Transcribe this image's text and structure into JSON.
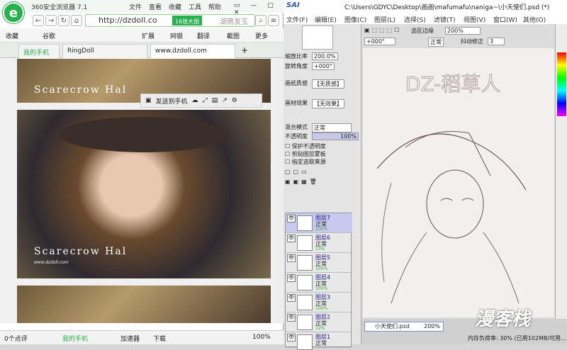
{
  "browser": {
    "logo": "e",
    "app_name": "360安全浏览器 7.1",
    "menu": [
      "文件",
      "查看",
      "收藏",
      "工具",
      "帮助"
    ],
    "url": "http://dzdoll.co",
    "hd_badge": "16张大图",
    "search_placeholder": "湖南发玉",
    "bookmarks": [
      "收藏",
      "谷歌"
    ],
    "toolbar": [
      "扩展",
      "网银",
      "翻译",
      "截图",
      "更多"
    ],
    "tabs": [
      "我的手机",
      "RingDoll",
      "www.dzdoll.com"
    ],
    "photo_caption": "Scarecrow Hal",
    "photo_sub": "www.dzdoll.com",
    "share_label": "发送到手机",
    "status": [
      "0个点评",
      "我的手机",
      "加速器",
      "下载",
      "100%"
    ]
  },
  "sai": {
    "brand": "SAI",
    "title": "C:\\Users\\GDYC\\Desktop\\画画\\mafumafu\\naniga~\\小天使们.psd (*)",
    "menu": [
      "文件(F)",
      "编辑(E)",
      "图像(C)",
      "图层(L)",
      "选择(S)",
      "滤镜(T)",
      "视图(V)",
      "窗口(W)",
      "其他(O)"
    ],
    "zoom_label": "缩放比率",
    "zoom_value": "200.0%",
    "rotate_label": "旋转角度",
    "rotate_value": "+000°",
    "texture_label": "画纸质感",
    "texture_value": "【无质感】",
    "effect_label": "画材效果",
    "effect_value": "【无效果】",
    "blend_label": "混合模式",
    "blend_value": "正常",
    "opacity_label": "不透明度",
    "opacity_value": "100%",
    "checks": [
      "保护不透明度",
      "剪贴图层蒙板",
      "指定选取来源"
    ],
    "canvas_toolbar": {
      "selection_edge": "选区边缘",
      "zoom": "200%",
      "angle": "+000°",
      "mode": "正常",
      "stabilizer_label": "抖动修正",
      "stabilizer": "3"
    },
    "layers": [
      {
        "name": "图层7",
        "mode": "正常",
        "pct": "100%"
      },
      {
        "name": "图层6",
        "mode": "正常",
        "pct": "13%"
      },
      {
        "name": "图层5",
        "mode": "正常",
        "pct": "100%"
      },
      {
        "name": "图层4",
        "mode": "正常",
        "pct": "100%"
      },
      {
        "name": "图层3",
        "mode": "正常",
        "pct": "100%"
      },
      {
        "name": "图层2",
        "mode": "正常",
        "pct": "12%"
      },
      {
        "name": "图层1",
        "mode": "正常",
        "pct": "100%"
      }
    ],
    "sketch_text": "DZ-稻草人",
    "doc_tab": "小天使们.psd",
    "doc_zoom": "200%",
    "status_text": "内存负荷率: 30% (已用102MB/可用...",
    "watermark": "漫客栈"
  }
}
